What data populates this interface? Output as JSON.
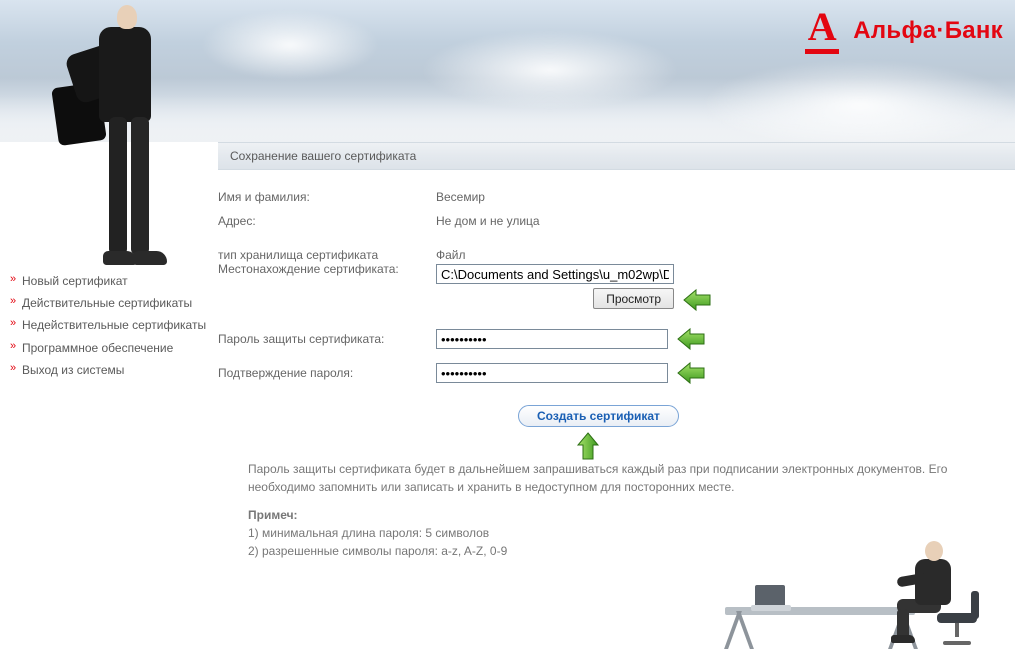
{
  "brand": {
    "name": "Альфа·Банк"
  },
  "section": {
    "title": "Сохранение вашего сертификата"
  },
  "sidebar": {
    "items": [
      {
        "label": "Новый сертификат"
      },
      {
        "label": "Действительные сертификаты"
      },
      {
        "label": "Недействительные сертификаты"
      },
      {
        "label": "Программное обеспечение"
      },
      {
        "label": "Выход из системы"
      }
    ]
  },
  "form": {
    "name_label": "Имя и фамилия:",
    "name_value": "Весемир",
    "address_label": "Адрес:",
    "address_value": "Не дом и не улица",
    "store_type_label": "тип хранилища сертификата",
    "store_type_value": "Файл",
    "location_label": "Местонахождение сертификата:",
    "location_value": "C:\\Documents and Settings\\u_m02wp\\D",
    "browse_label": "Просмотр",
    "password_label": "Пароль защиты сертификата:",
    "password_value": "••••••••••",
    "confirm_label": "Подтверждение пароля:",
    "confirm_value": "••••••••••",
    "create_label": "Создать сертификат"
  },
  "notes": {
    "p1": "Пароль защиты сертификата будет в дальнейшем запрашиваться каждый раз при подписании электронных документов. Его необходимо запомнить или записать и хранить в недоступном для посторонних месте.",
    "head": "Примеч:",
    "l1": "1) минимальная длина пароля: 5 символов",
    "l2": "2) разрешенные символы пароля: a-z, A-Z, 0-9"
  }
}
